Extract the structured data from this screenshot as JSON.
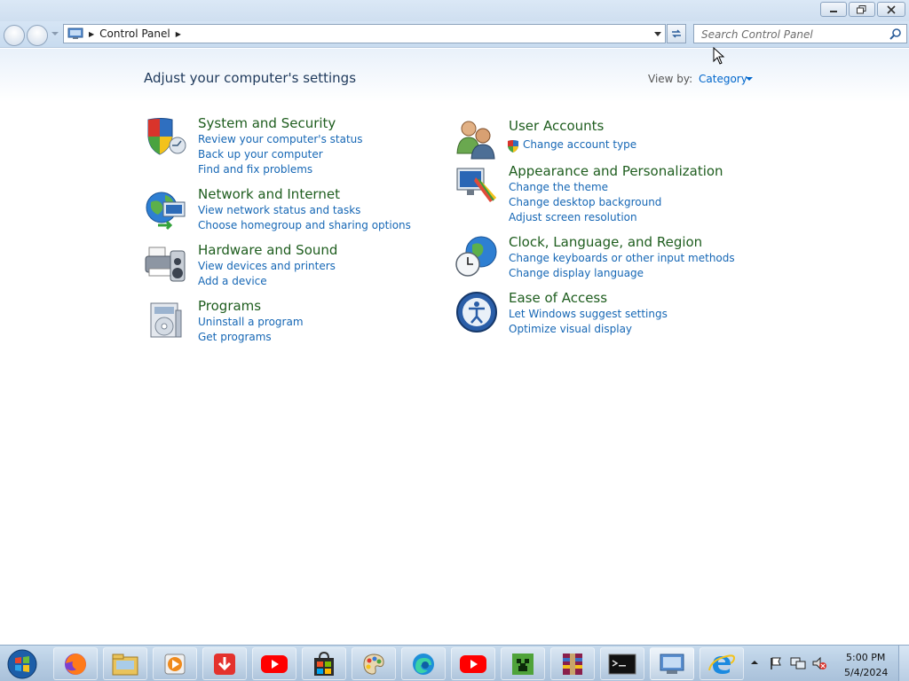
{
  "window": {
    "buttons": {
      "minimize": "minimize",
      "maximize": "restore",
      "close": "close"
    }
  },
  "navbar": {
    "breadcrumb": [
      "Control Panel"
    ],
    "search": {
      "placeholder": "Search Control Panel",
      "value": ""
    }
  },
  "content": {
    "title": "Adjust your computer's settings",
    "view_by_label": "View by:",
    "view_by_value": "Category"
  },
  "categories": [
    {
      "title": "System and Security",
      "icon": "shield-icon",
      "links": [
        "Review your computer's status",
        "Back up your computer",
        "Find and fix problems"
      ]
    },
    {
      "title": "Network and Internet",
      "icon": "network-globe-icon",
      "links": [
        "View network status and tasks",
        "Choose homegroup and sharing options"
      ]
    },
    {
      "title": "Hardware and Sound",
      "icon": "printer-speaker-icon",
      "links": [
        "View devices and printers",
        "Add a device"
      ]
    },
    {
      "title": "Programs",
      "icon": "programs-box-icon",
      "links": [
        "Uninstall a program",
        "Get programs"
      ]
    },
    {
      "title": "User Accounts",
      "icon": "users-icon",
      "links": [
        "Change account type"
      ]
    },
    {
      "title": "Appearance and Personalization",
      "icon": "monitor-palette-icon",
      "links": [
        "Change the theme",
        "Change desktop background",
        "Adjust screen resolution"
      ]
    },
    {
      "title": "Clock, Language, and Region",
      "icon": "clock-globe-icon",
      "links": [
        "Change keyboards or other input methods",
        "Change display language"
      ]
    },
    {
      "title": "Ease of Access",
      "icon": "ease-of-access-icon",
      "links": [
        "Let Windows suggest settings",
        "Optimize visual display"
      ]
    }
  ],
  "taskbar": {
    "items": [
      "windows-start-icon",
      "firefox-icon",
      "file-explorer-icon",
      "media-player-icon",
      "downloader-icon",
      "youtube-icon",
      "store-bag-icon",
      "paint-palette-icon",
      "edge-icon",
      "youtube-icon",
      "minecraft-icon",
      "winrar-icon",
      "command-prompt-icon",
      "control-panel-icon",
      "internet-explorer-icon"
    ],
    "clock_time": "5:00 PM",
    "clock_date": "5/4/2024"
  },
  "colors": {
    "link": "#1667b5",
    "category_title": "#1e5d1e",
    "page_title": "#1e395b",
    "taskbar": "#b7cde3"
  }
}
